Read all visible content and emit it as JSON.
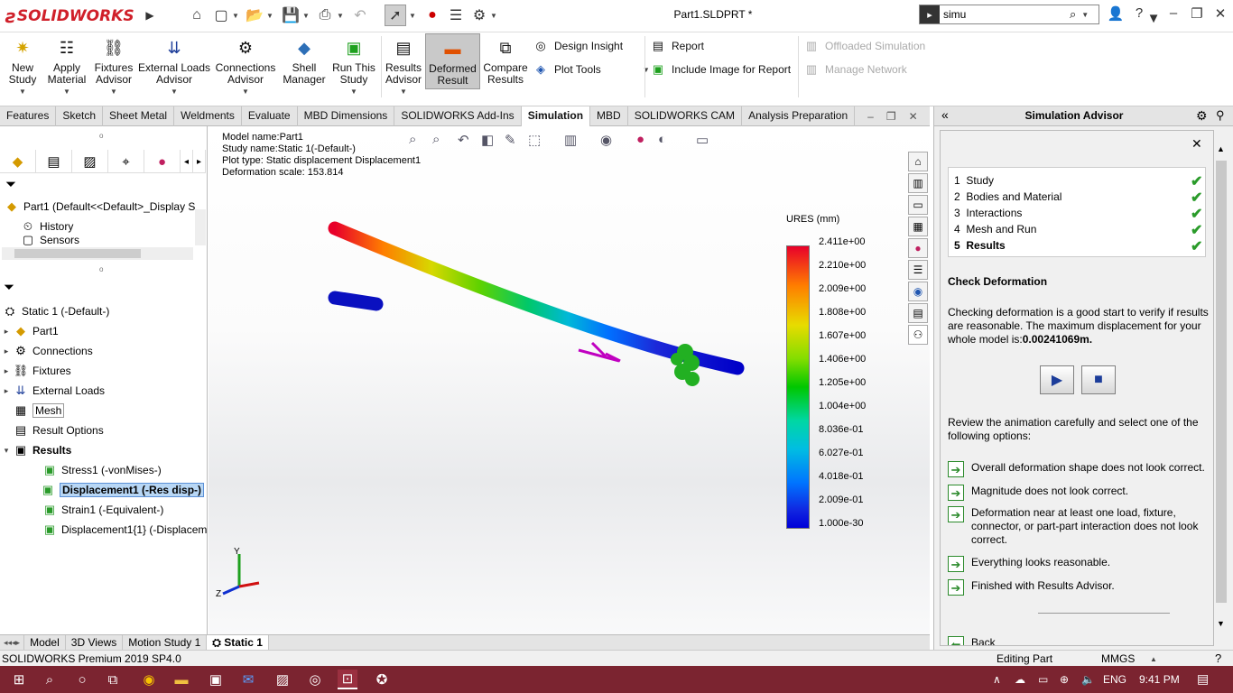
{
  "app": {
    "logo": "SOLIDWORKS",
    "document_title": "Part1.SLDPRT *"
  },
  "search": {
    "value": "simu"
  },
  "ribbon": {
    "buttons": [
      {
        "label": "New Study"
      },
      {
        "label": "Apply Material"
      },
      {
        "label": "Fixtures Advisor"
      },
      {
        "label": "External Loads Advisor"
      },
      {
        "label": "Connections Advisor"
      },
      {
        "label": "Shell Manager"
      },
      {
        "label": "Run This Study"
      },
      {
        "label": "Results Advisor"
      },
      {
        "label": "Deformed Result"
      },
      {
        "label": "Compare Results"
      }
    ],
    "design_insight": "Design Insight",
    "plot_tools": "Plot Tools",
    "report": "Report",
    "include_image": "Include Image for Report",
    "offloaded": "Offloaded Simulation",
    "manage_network": "Manage Network"
  },
  "tabs": [
    "Features",
    "Sketch",
    "Sheet Metal",
    "Weldments",
    "Evaluate",
    "MBD Dimensions",
    "SOLIDWORKS Add-Ins",
    "Simulation",
    "MBD",
    "SOLIDWORKS CAM",
    "Analysis Preparation"
  ],
  "active_tab": "Simulation",
  "feature_tree": {
    "part_label": "Part1  (Default<<Default>_Display S",
    "history": "History",
    "sensors": "Sensors"
  },
  "sim_tree": {
    "study": "Static 1 (-Default-)",
    "items": [
      {
        "label": "Part1"
      },
      {
        "label": "Connections"
      },
      {
        "label": "Fixtures"
      },
      {
        "label": "External Loads"
      },
      {
        "label": "Mesh"
      },
      {
        "label": "Result Options"
      },
      {
        "label": "Results"
      }
    ],
    "results": [
      {
        "label": "Stress1 (-vonMises-)"
      },
      {
        "label": "Displacement1 (-Res disp-)"
      },
      {
        "label": "Strain1 (-Equivalent-)"
      },
      {
        "label": "Displacement1{1} (-Displacem"
      }
    ]
  },
  "viewport": {
    "model_name": "Model name:Part1",
    "study_name": "Study name:Static 1(-Default-)",
    "plot_type": "Plot type: Static displacement Displacement1",
    "deformation_scale": "Deformation scale: 153.814",
    "scale_title": "URES (mm)",
    "scale_labels": [
      "2.411e+00",
      "2.210e+00",
      "2.009e+00",
      "1.808e+00",
      "1.607e+00",
      "1.406e+00",
      "1.205e+00",
      "1.004e+00",
      "8.036e-01",
      "6.027e-01",
      "4.018e-01",
      "2.009e-01",
      "1.000e-30"
    ],
    "axes": {
      "y": "Y",
      "z": "Z"
    }
  },
  "advisor": {
    "title": "Simulation Advisor",
    "steps": [
      {
        "num": "1",
        "label": "Study"
      },
      {
        "num": "2",
        "label": "Bodies and Material"
      },
      {
        "num": "3",
        "label": "Interactions"
      },
      {
        "num": "4",
        "label": "Mesh and Run"
      },
      {
        "num": "5",
        "label": "Results"
      }
    ],
    "heading": "Check Deformation",
    "intro": "Checking deformation is a good start to verify if results are reasonable. The maximum displacement for your whole model is:",
    "max_disp": "0.00241069m.",
    "review": "Review the animation carefully and select one of the following options:",
    "options": [
      "Overall deformation shape does not look correct.",
      "Magnitude does not look correct.",
      "Deformation near at least one load, fixture, connector, or part-part interaction does not look correct.",
      "Everything looks reasonable.",
      "Finished with Results Advisor."
    ],
    "back": "Back"
  },
  "bottom_tabs": [
    "Model",
    "3D Views",
    "Motion Study 1",
    "Static 1"
  ],
  "status": {
    "product": "SOLIDWORKS Premium 2019 SP4.0",
    "mode": "Editing Part",
    "units": "MMGS"
  },
  "taskbar": {
    "lang": "ENG",
    "time": "9:41 PM"
  }
}
